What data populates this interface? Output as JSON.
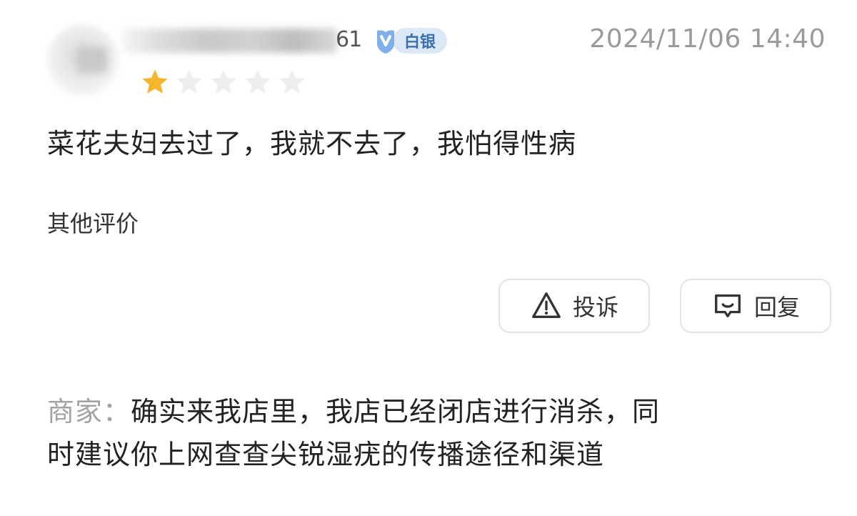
{
  "review": {
    "username_visible_tail": "61",
    "level_badge": "白银",
    "timestamp": "2024/11/06 14:40",
    "rating": 1,
    "rating_max": 5,
    "text": "菜花夫妇去过了，我就不去了，我怕得性病",
    "other_reviews_label": "其他评价"
  },
  "actions": {
    "complain_label": "投诉",
    "reply_label": "回复"
  },
  "merchant_reply": {
    "label": "商家：",
    "line1": "确实来我店里，我店已经闭店进行消杀，同",
    "line2": "时建议你上网查查尖锐湿疣的传播途径和渠道"
  },
  "colors": {
    "star_filled": "#f7b52c",
    "star_empty": "#eeeeee",
    "badge_bg": "#dbe8f6",
    "badge_text": "#3d6fae",
    "timestamp": "#9a9a9a",
    "merchant_label": "#a3a3a3"
  },
  "icons": {
    "complain": "warning-triangle-icon",
    "reply": "message-box-icon",
    "level": "silver-level-icon",
    "star": "star-icon"
  }
}
